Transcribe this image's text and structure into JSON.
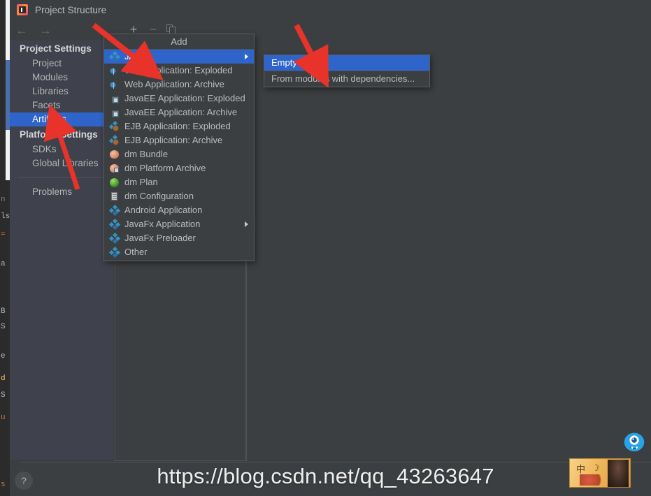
{
  "window": {
    "title": "Project Structure",
    "app_icon": "intellij-idea-icon"
  },
  "nav": {
    "back_label": "←",
    "forward_label": "→"
  },
  "sidebar": {
    "groups": [
      {
        "label": "Project Settings",
        "items": [
          {
            "label": "Project",
            "selected": false
          },
          {
            "label": "Modules",
            "selected": false
          },
          {
            "label": "Libraries",
            "selected": false
          },
          {
            "label": "Facets",
            "selected": false
          },
          {
            "label": "Artifacts",
            "selected": true
          }
        ]
      },
      {
        "label": "Platform Settings",
        "items": [
          {
            "label": "SDKs",
            "selected": false
          },
          {
            "label": "Global Libraries",
            "selected": false
          }
        ]
      }
    ],
    "problems_label": "Problems"
  },
  "toolbar": {
    "add_label": "+",
    "remove_label": "−",
    "copy_label": "copy-icon"
  },
  "add_menu": {
    "title": "Add",
    "items": [
      {
        "label": "JAR",
        "icon": "diamond-icon",
        "selected": true,
        "submenu": true
      },
      {
        "label": "Web Application: Exploded",
        "icon": "web-icon",
        "selected": false,
        "submenu": false
      },
      {
        "label": "Web Application: Archive",
        "icon": "web-icon",
        "selected": false,
        "submenu": false
      },
      {
        "label": "JavaEE Application: Exploded",
        "icon": "javaee-icon",
        "selected": false,
        "submenu": false
      },
      {
        "label": "JavaEE Application: Archive",
        "icon": "javaee-icon",
        "selected": false,
        "submenu": false
      },
      {
        "label": "EJB Application: Exploded",
        "icon": "ejb-icon",
        "selected": false,
        "submenu": false
      },
      {
        "label": "EJB Application: Archive",
        "icon": "ejb-icon",
        "selected": false,
        "submenu": false
      },
      {
        "label": "dm Bundle",
        "icon": "dm-bundle-icon",
        "selected": false,
        "submenu": false
      },
      {
        "label": "dm Platform Archive",
        "icon": "dm-archive-icon",
        "selected": false,
        "submenu": false
      },
      {
        "label": "dm Plan",
        "icon": "dm-plan-icon",
        "selected": false,
        "submenu": false
      },
      {
        "label": "dm Configuration",
        "icon": "dm-config-icon",
        "selected": false,
        "submenu": false
      },
      {
        "label": "Android Application",
        "icon": "diamond-icon",
        "selected": false,
        "submenu": false
      },
      {
        "label": "JavaFx Application",
        "icon": "diamond-icon",
        "selected": false,
        "submenu": true
      },
      {
        "label": "JavaFx Preloader",
        "icon": "diamond-icon",
        "selected": false,
        "submenu": false
      },
      {
        "label": "Other",
        "icon": "diamond-icon",
        "selected": false,
        "submenu": false
      }
    ]
  },
  "jar_submenu": {
    "items": [
      {
        "label": "Empty",
        "selected": true
      },
      {
        "label": "From modules with dependencies...",
        "selected": false
      }
    ]
  },
  "footer": {
    "help_label": "?"
  },
  "watermark": {
    "text": "https://blog.csdn.net/qq_43263647"
  },
  "overlay": {
    "ime_zh": "中",
    "ime_moon": "☽",
    "monster_name": "blue-monster-search-icon"
  },
  "background_editor": {
    "lines": [
      "n",
      "ls",
      "=",
      "a",
      "B",
      "S",
      "e",
      "d",
      "S",
      "u",
      "s"
    ]
  },
  "colors": {
    "dialog_bg": "#3c3f41",
    "sidebar_bg": "#3f424d",
    "selection_blue": "#2f65ca",
    "text": "#bbbbbb",
    "arrow_red": "#e8332a"
  }
}
